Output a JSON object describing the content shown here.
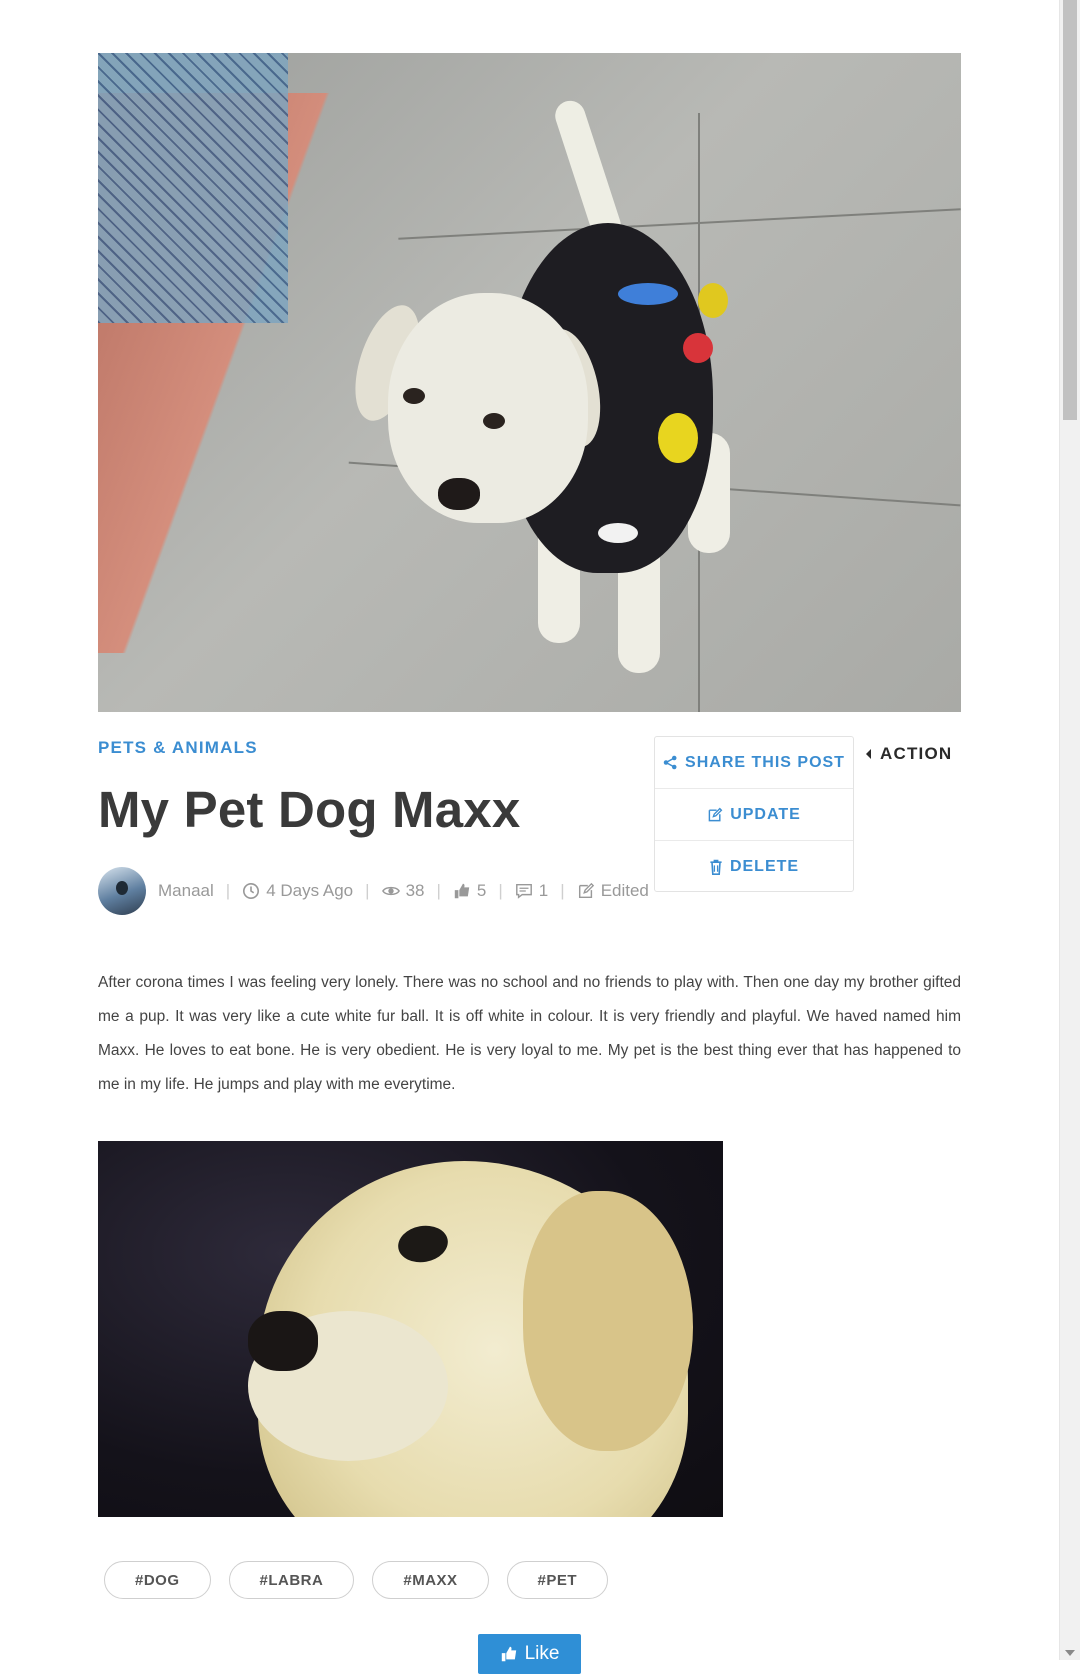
{
  "post": {
    "category": "PETS & ANIMALS",
    "title": "My Pet Dog Maxx",
    "author": "Manaal",
    "time_ago": "4 Days Ago",
    "views": "38",
    "likes": "5",
    "comments": "1",
    "edited_label": "Edited",
    "body": "After corona times I was feeling very lonely. There was no school and no friends to play with. Then one day my brother gifted me a pup. It was very like a cute white fur ball. It is off white in colour. It is very friendly and playful. We haved named him Maxx. He loves to eat bone. He is very obedient. He is very loyal to me. My pet is the best thing ever that has happened to me in my life. He jumps and play with me everytime.",
    "tags": [
      "#DOG",
      "#LABRA",
      "#MAXX",
      "#PET"
    ]
  },
  "actions": {
    "toggle_label": "ACTION",
    "share_label": "SHARE THIS POST",
    "update_label": "UPDATE",
    "delete_label": "DELETE"
  },
  "like_button": {
    "label": "Like"
  },
  "colors": {
    "accent": "#3b8dd1",
    "title": "#3a3a3a",
    "meta": "#999999",
    "button": "#2f8fd6"
  }
}
